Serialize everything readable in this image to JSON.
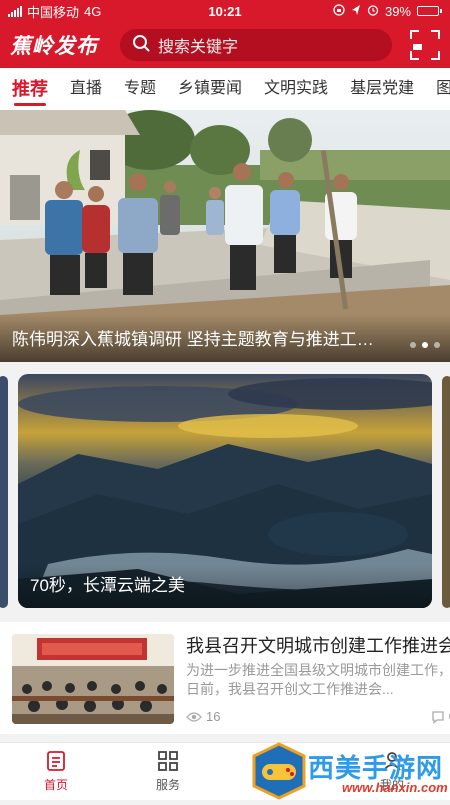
{
  "status_bar": {
    "carrier": "中国移动",
    "network": "4G",
    "time": "10:21",
    "battery": "39%",
    "battery_level": 0.39
  },
  "header": {
    "logo": "蕉岭发布",
    "search_placeholder": "搜索关键字",
    "brand_color": "#d8192b"
  },
  "tabs": [
    {
      "label": "推荐",
      "active": true
    },
    {
      "label": "直播"
    },
    {
      "label": "专题"
    },
    {
      "label": "乡镇要闻"
    },
    {
      "label": "文明实践"
    },
    {
      "label": "基层党建"
    },
    {
      "label": "图"
    }
  ],
  "hero": {
    "caption": "陈伟明深入蕉城镇调研 坚持主题教育与推进工作相结合",
    "slide_count": 3,
    "active_slide": 2
  },
  "video_card": {
    "caption": "70秒，长潭云端之美"
  },
  "news": {
    "title": "我县召开文明城市创建工作推进会",
    "desc": "为进一步推进全国县级文明城市创建工作，日前，我县召开创文工作推进会...",
    "views": "16",
    "comments": "0"
  },
  "bottom_nav": [
    {
      "label": "首页",
      "icon": "home-doc-icon",
      "active": true
    },
    {
      "label": "服务",
      "icon": "grid-icon"
    },
    {
      "label": "",
      "icon": "center-icon"
    },
    {
      "label": "我的",
      "icon": "user-icon"
    }
  ],
  "watermark": {
    "text": "西美手游网",
    "url": "www.hanxin.com"
  }
}
